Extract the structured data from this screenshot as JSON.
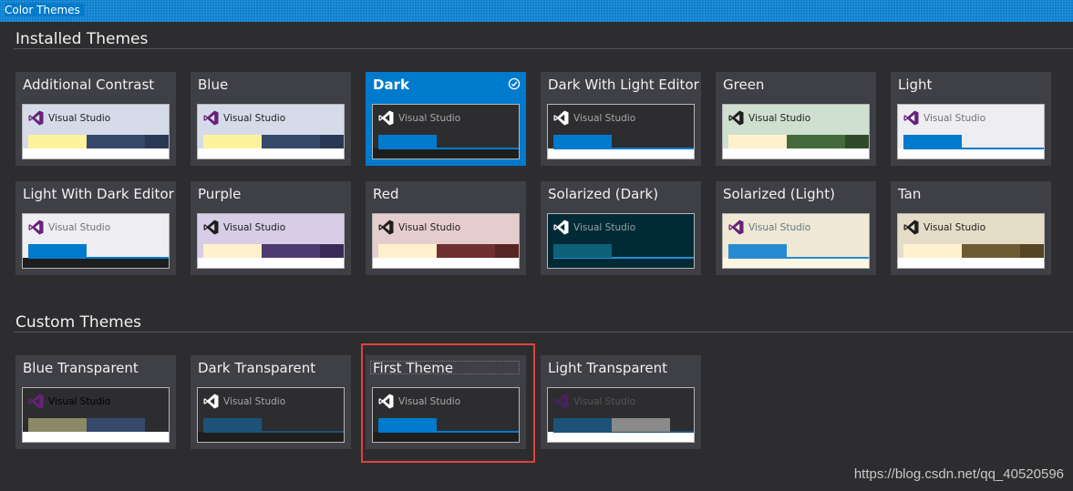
{
  "window": {
    "title": "Color Themes"
  },
  "installed": {
    "header": "Installed Themes",
    "cards": [
      {
        "label": "Additional Contrast",
        "selected": false,
        "theme": {
          "bg": "#d6dbe9",
          "logo": "#68217a",
          "text": "#1e1e1e",
          "bar1": "#fff29d",
          "bar2": "#35496a",
          "bar3": "#293955",
          "bottom": "#ffffff",
          "underline": ""
        }
      },
      {
        "label": "Blue",
        "selected": false,
        "theme": {
          "bg": "#d6dbe9",
          "logo": "#68217a",
          "text": "#1e1e1e",
          "bar1": "#fff29d",
          "bar2": "#35496a",
          "bar3": "#293955",
          "bottom": "#ffffff",
          "underline": ""
        }
      },
      {
        "label": "Dark",
        "selected": true,
        "theme": {
          "bg": "#2d2d30",
          "logo": "#ffffff",
          "text": "#a8a8a8",
          "bar1": "#007acc",
          "bar2": "",
          "bar3": "",
          "bottom": "#1e1e1e",
          "underline": "#007acc"
        }
      },
      {
        "label": "Dark With Light Editor",
        "selected": false,
        "theme": {
          "bg": "#2d2d30",
          "logo": "#ffffff",
          "text": "#a8a8a8",
          "bar1": "#007acc",
          "bar2": "",
          "bar3": "",
          "bottom": "#ffffff",
          "underline": "#007acc"
        }
      },
      {
        "label": "Green",
        "selected": false,
        "theme": {
          "bg": "#cfdfd0",
          "logo": "#1e1e1e",
          "text": "#1e1e1e",
          "bar1": "#fff1cc",
          "bar2": "#44693c",
          "bar3": "#2f4a2b",
          "bottom": "#ffffff",
          "underline": ""
        }
      },
      {
        "label": "Light",
        "selected": false,
        "theme": {
          "bg": "#eeeef2",
          "logo": "#68217a",
          "text": "#717171",
          "bar1": "#007acc",
          "bar2": "",
          "bar3": "",
          "bottom": "#ffffff",
          "underline": "#007acc"
        }
      },
      {
        "label": "Light With Dark Editor",
        "selected": false,
        "theme": {
          "bg": "#eeeef2",
          "logo": "#68217a",
          "text": "#717171",
          "bar1": "#007acc",
          "bar2": "",
          "bar3": "",
          "bottom": "#1e1e1e",
          "underline": "#007acc"
        }
      },
      {
        "label": "Purple",
        "selected": false,
        "theme": {
          "bg": "#d7cde6",
          "logo": "#1e1e1e",
          "text": "#1e1e1e",
          "bar1": "#fff1cc",
          "bar2": "#4c3a71",
          "bar3": "#3a2a5a",
          "bottom": "#ffffff",
          "underline": ""
        }
      },
      {
        "label": "Red",
        "selected": false,
        "theme": {
          "bg": "#e6cdcd",
          "logo": "#1e1e1e",
          "text": "#1e1e1e",
          "bar1": "#fff1cc",
          "bar2": "#6e3030",
          "bar3": "#572424",
          "bottom": "#ffffff",
          "underline": ""
        }
      },
      {
        "label": "Solarized (Dark)",
        "selected": false,
        "theme": {
          "bg": "#002b36",
          "logo": "#ffffff",
          "text": "#93a1a1",
          "bar1": "#0e6178",
          "bar2": "",
          "bar3": "",
          "bottom": "#002b36",
          "underline": "#268bd2"
        }
      },
      {
        "label": "Solarized (Light)",
        "selected": false,
        "theme": {
          "bg": "#eee8d5",
          "logo": "#68217a",
          "text": "#657b83",
          "bar1": "#268bd2",
          "bar2": "",
          "bar3": "",
          "bottom": "#fdf6e3",
          "underline": "#268bd2"
        }
      },
      {
        "label": "Tan",
        "selected": false,
        "theme": {
          "bg": "#e5dcc7",
          "logo": "#1e1e1e",
          "text": "#1e1e1e",
          "bar1": "#fff1cc",
          "bar2": "#6e5b33",
          "bar3": "#554522",
          "bottom": "#ffffff",
          "underline": ""
        }
      }
    ]
  },
  "custom": {
    "header": "Custom Themes",
    "cards": [
      {
        "label": "Blue Transparent",
        "selected": false,
        "theme": {
          "bg": "#2d2d30",
          "logo": "#68217a",
          "text": "#000000",
          "bar1": "#8b8966",
          "bar2": "#35496a",
          "bar3": "#2d2d30",
          "bottom": "#ffffff",
          "underline": ""
        }
      },
      {
        "label": "Dark Transparent",
        "selected": false,
        "theme": {
          "bg": "#2d2d30",
          "logo": "#ffffff",
          "text": "#a8a8a8",
          "bar1": "#1c5178",
          "bar2": "",
          "bar3": "",
          "bottom": "#1e1e1e",
          "underline": "#1c5178"
        }
      },
      {
        "label": "First Theme",
        "selected": false,
        "theme": {
          "bg": "#2d2d30",
          "logo": "#ffffff",
          "text": "#a8a8a8",
          "bar1": "#007acc",
          "bar2": "",
          "bar3": "",
          "bottom": "#1e1e1e",
          "underline": "#007acc"
        }
      },
      {
        "label": "Light Transparent",
        "selected": false,
        "theme": {
          "bg": "#2d2d30",
          "logo": "#4b2060",
          "text": "#555555",
          "bar1": "#1c5178",
          "bar2": "#8a8a8a",
          "bar3": "",
          "bottom": "#ffffff",
          "underline": "#1c5178"
        }
      }
    ]
  },
  "preview_label": "Visual Studio",
  "watermark": "https://blog.csdn.net/qq_40520596"
}
